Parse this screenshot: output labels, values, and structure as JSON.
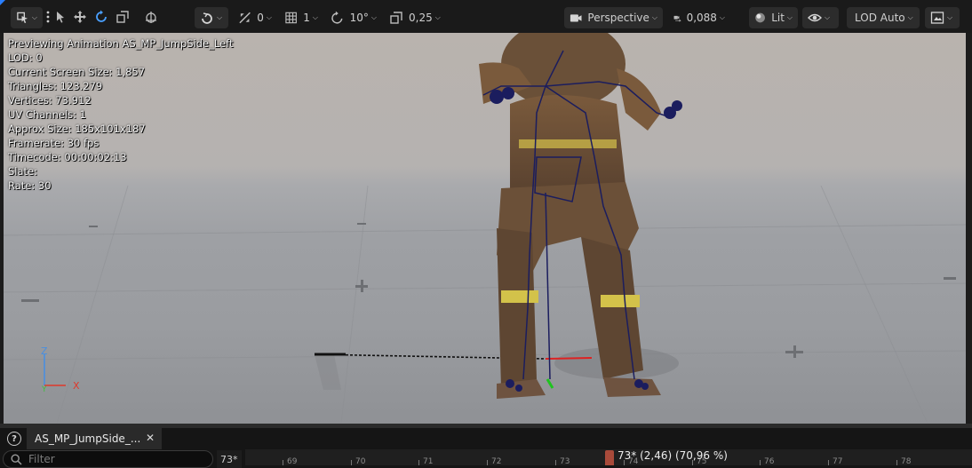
{
  "toolbar": {
    "translation_snap": "0",
    "grid_snap": "1",
    "rotation_snap": "10°",
    "scale_snap": "0,25",
    "view_mode": "Perspective",
    "camera_speed": "0,088",
    "lighting_mode": "Lit",
    "lod_mode": "LOD Auto",
    "icons": [
      "select-mode-icon",
      "more-options-icon",
      "select-arrow-icon",
      "translate-icon",
      "rotate-icon",
      "scale-icon",
      "pivot-space-icon",
      "surface-snap-icon",
      "translation-snap-icon",
      "grid-snap-icon",
      "rotation-snap-icon",
      "scale-snap-icon",
      "camera-icon",
      "camera-speed-icon",
      "lit-sphere-icon",
      "show-eye-icon",
      "layout-icon"
    ]
  },
  "viewport": {
    "stats": [
      "Previewing Animation AS_MP_JumpSide_Left",
      "LOD: 0",
      "Current Screen Size: 1,857",
      "Triangles: 123.279",
      "Vertices: 73.912",
      "UV Channels: 1",
      "Approx Size: 185x101x187",
      "Framerate: 30 fps",
      "Timecode: 00:00:02:13",
      "Slate:",
      "Rate: 30"
    ],
    "axis": {
      "z": "Z",
      "y": "Y",
      "x": "X"
    },
    "colors": {
      "axis_x": "#e0392b",
      "axis_y": "#3fbf3f",
      "axis_z": "#4a8fe0",
      "skeleton": "#16185a"
    }
  },
  "timeline": {
    "tab_label": "AS_MP_JumpSide_...",
    "filter_placeholder": "Filter",
    "current_frame": "73*",
    "ticks": [
      "69",
      "70",
      "71",
      "72",
      "73",
      "74",
      "75",
      "76",
      "77",
      "78"
    ],
    "playhead_label": "73* (2,46) (70,96 %)",
    "playhead_color": "#a84a3a"
  }
}
